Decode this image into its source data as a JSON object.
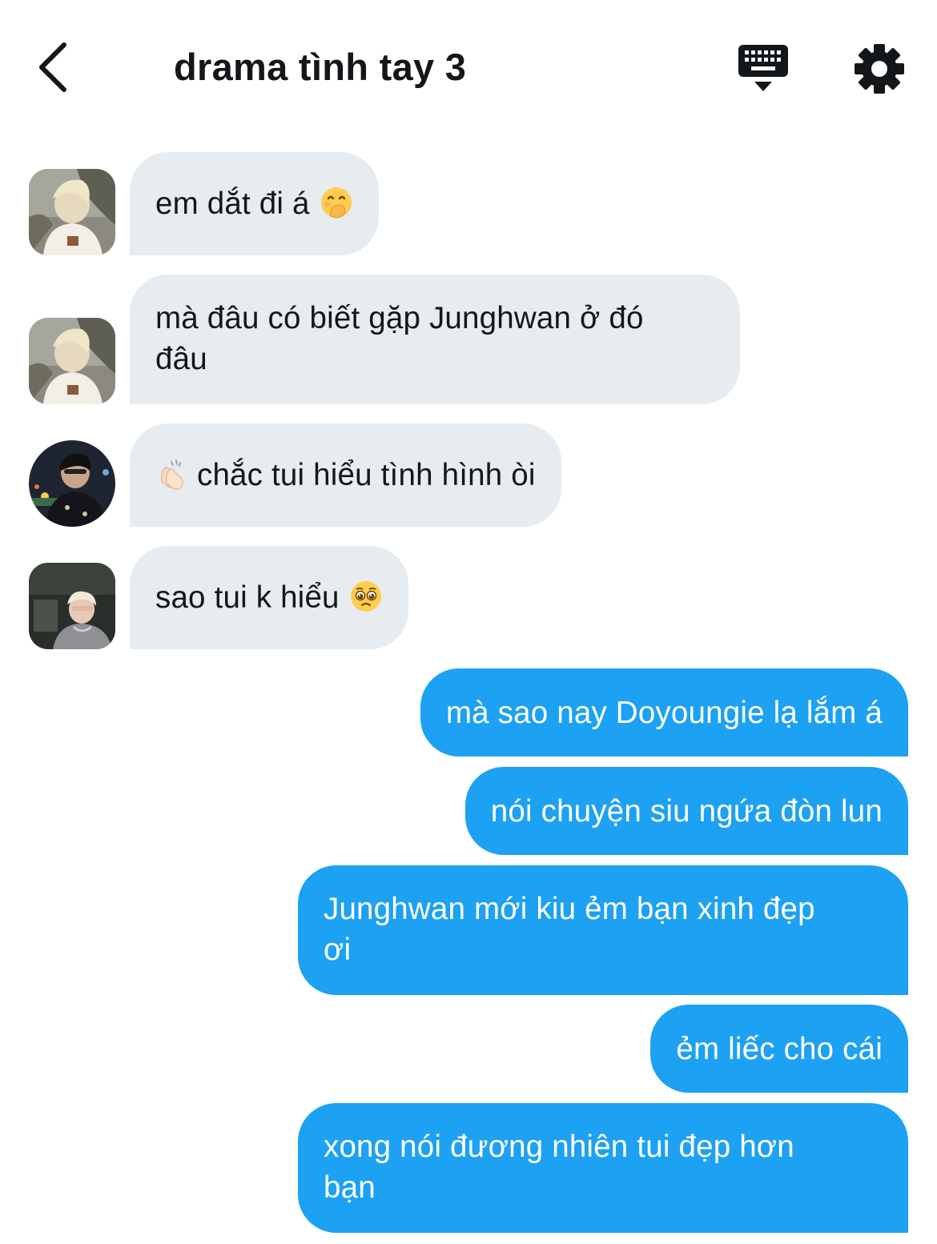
{
  "header": {
    "title": "drama tình tay 3",
    "back_icon": "chevron-left-icon",
    "keyboard_icon": "keyboard-icon",
    "settings_icon": "gear-icon"
  },
  "colors": {
    "incoming_bubble": "#e6ecf0",
    "outgoing_bubble": "#1da1f2",
    "text": "#14171a"
  },
  "messages": [
    {
      "direction": "in",
      "text": "em dắt đi á",
      "emoji": "hand-over-mouth-emoji"
    },
    {
      "direction": "in",
      "text": "mà đâu có biết gặp Junghwan ở đó\nđâu"
    },
    {
      "direction": "in",
      "text": "chắc tui hiểu tình hình òi",
      "emoji": "clapping-hands-emoji"
    },
    {
      "direction": "in",
      "text": "sao tui k hiểu",
      "emoji": "pleading-face-emoji"
    },
    {
      "direction": "out",
      "text": "mà sao nay Doyoungie lạ lắm á"
    },
    {
      "direction": "out",
      "text": "nói chuyện siu ngứa đòn lun"
    },
    {
      "direction": "out",
      "text": "Junghwan mới kiu ẻm bạn xinh đẹp\nơi"
    },
    {
      "direction": "out",
      "text": "ẻm liếc cho cái"
    },
    {
      "direction": "out",
      "text": "xong nói đương nhiên tui đẹp hơn\nbạn"
    }
  ]
}
